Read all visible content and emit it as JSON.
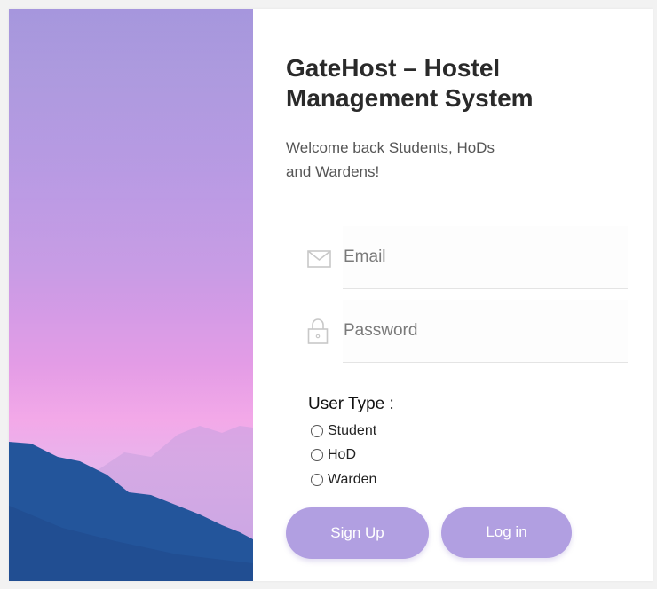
{
  "app": {
    "title": "GateHost – Hostel Management System",
    "welcome": "Welcome back Students, HoDs and Wardens!"
  },
  "form": {
    "email_placeholder": "Email",
    "password_placeholder": "Password",
    "user_type_label": "User Type :",
    "user_types": [
      "Student",
      "HoD",
      "Warden"
    ],
    "selected_user_type": null
  },
  "buttons": {
    "signup": "Sign Up",
    "login": "Log in"
  },
  "icons": {
    "email": "envelope-icon",
    "password": "lock-icon"
  },
  "colors": {
    "accent": "#b19fe1",
    "mountain": "#23559b"
  }
}
